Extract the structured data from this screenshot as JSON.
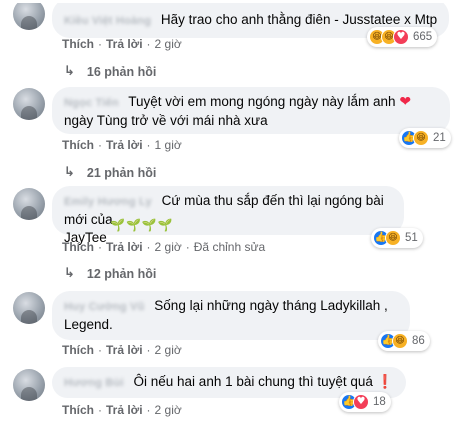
{
  "actions": {
    "like": "Thích",
    "reply": "Trả lời",
    "edited": "Đã chỉnh sửa"
  },
  "comments": [
    {
      "author": "Kiều Việt Hoàng",
      "text": "Hãy trao cho anh thằng điên - Jusstatee x Mtp",
      "reactions": [
        "haha-icon",
        "haha-icon",
        "love-icon"
      ],
      "count": "665",
      "time": "2 giờ",
      "replies": "16 phản hồi"
    },
    {
      "author": "Ngọc Tiến",
      "line1": "Tuyệt vời em mong ngóng ngày này lắm anh",
      "line2": "ngày Tùng trở về với mái nhà xưa",
      "trailing_emoji": "❤",
      "count": "21",
      "time": "1 giờ",
      "replies": "21 phản hồi"
    },
    {
      "author": "Emily Hương Ly",
      "line1": "Cứ mùa thu sắp đến thì lại ngóng bài mới của",
      "line2": "JayTee",
      "trailing_emoji": "🌱🌱🌱🌱",
      "count": "51",
      "time": "2 giờ",
      "replies": "12 phản hồi"
    },
    {
      "author": "Huy Cường Vũ",
      "line1": "Sống lại những ngày tháng Ladykillah ,",
      "line2": "Legend.",
      "count": "86",
      "time": "2 giờ"
    },
    {
      "author": "Hương Bùi",
      "text": "Ôi nếu hai anh 1 bài chung thì tuyệt quá",
      "trailing_emoji": "❗",
      "count": "18",
      "time": "2 giờ"
    }
  ],
  "colors": {
    "bubble": "#f0f2f5",
    "meta": "#65676b",
    "like": "#1877f2",
    "love": "#f33e58",
    "haha": "#f7b125"
  }
}
